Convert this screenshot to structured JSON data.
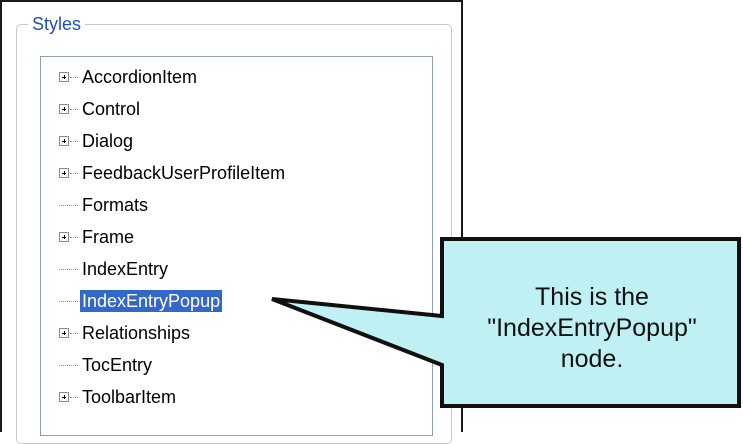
{
  "group": {
    "legend": "Styles"
  },
  "tree": {
    "nodes": [
      {
        "label": "AccordionItem",
        "expandable": true,
        "selected": false
      },
      {
        "label": "Control",
        "expandable": true,
        "selected": false
      },
      {
        "label": "Dialog",
        "expandable": true,
        "selected": false
      },
      {
        "label": "FeedbackUserProfileItem",
        "expandable": true,
        "selected": false
      },
      {
        "label": "Formats",
        "expandable": false,
        "selected": false
      },
      {
        "label": "Frame",
        "expandable": true,
        "selected": false
      },
      {
        "label": "IndexEntry",
        "expandable": false,
        "selected": false
      },
      {
        "label": "IndexEntryPopup",
        "expandable": false,
        "selected": true
      },
      {
        "label": "Relationships",
        "expandable": true,
        "selected": false
      },
      {
        "label": "TocEntry",
        "expandable": false,
        "selected": false
      },
      {
        "label": "ToolbarItem",
        "expandable": true,
        "selected": false
      }
    ]
  },
  "callout": {
    "line1": "This is the",
    "line2": "\"IndexEntryPopup\"",
    "line3": "node.",
    "fill_color": "#bff0f4",
    "border_color": "#101010"
  },
  "colors": {
    "selection": "#3468c8",
    "legend": "#1f4fbf"
  }
}
